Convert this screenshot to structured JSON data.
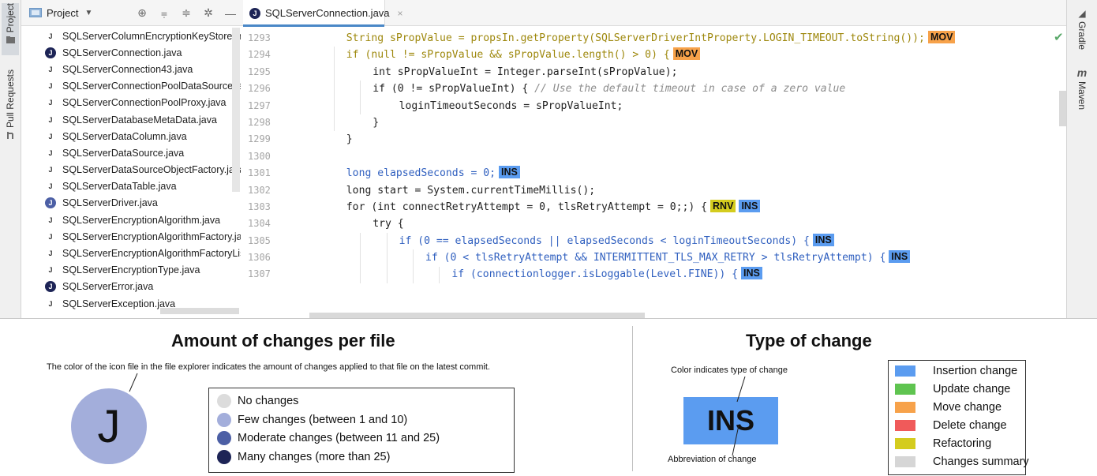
{
  "left_toolwindows": [
    {
      "label": "Project",
      "active": true
    },
    {
      "label": "Pull Requests",
      "active": false
    }
  ],
  "right_toolwindows": [
    {
      "label": "Gradle",
      "icon": "gradle-elephant-icon"
    },
    {
      "label": "Maven",
      "icon_text": "m"
    }
  ],
  "project_panel": {
    "title": "Project",
    "tools": [
      "target-icon",
      "collapse-all-icon",
      "expand-all-icon",
      "gear-icon",
      "minimize-icon"
    ]
  },
  "files": [
    {
      "name": "SQLServerColumnEncryptionKeyStorePro",
      "changes": "none"
    },
    {
      "name": "SQLServerConnection.java",
      "changes": "many"
    },
    {
      "name": "SQLServerConnection43.java",
      "changes": "none"
    },
    {
      "name": "SQLServerConnectionPoolDataSource.jav",
      "changes": "none"
    },
    {
      "name": "SQLServerConnectionPoolProxy.java",
      "changes": "none"
    },
    {
      "name": "SQLServerDatabaseMetaData.java",
      "changes": "none"
    },
    {
      "name": "SQLServerDataColumn.java",
      "changes": "none"
    },
    {
      "name": "SQLServerDataSource.java",
      "changes": "none"
    },
    {
      "name": "SQLServerDataSourceObjectFactory.java",
      "changes": "none"
    },
    {
      "name": "SQLServerDataTable.java",
      "changes": "none"
    },
    {
      "name": "SQLServerDriver.java",
      "changes": "moderate"
    },
    {
      "name": "SQLServerEncryptionAlgorithm.java",
      "changes": "none"
    },
    {
      "name": "SQLServerEncryptionAlgorithmFactory.jav",
      "changes": "none"
    },
    {
      "name": "SQLServerEncryptionAlgorithmFactoryList",
      "changes": "none"
    },
    {
      "name": "SQLServerEncryptionType.java",
      "changes": "none"
    },
    {
      "name": "SQLServerError.java",
      "changes": "many"
    },
    {
      "name": "SQLServerException.java",
      "changes": "none"
    }
  ],
  "file_icon_letter": "J",
  "editor_tab": {
    "title": "SQLServerConnection.java",
    "close": "×"
  },
  "code_lines": [
    {
      "num": "1293",
      "indent": 2,
      "text": "String sPropValue = propsIn.getProperty(SQLServerDriverIntProperty.LOGIN_TIMEOUT.toString());",
      "color": "#9e880d",
      "tags": [
        "MOV"
      ]
    },
    {
      "num": "1294",
      "indent": 2,
      "text": "if (null != sPropValue && sPropValue.length() > 0) {",
      "color": "#9e880d",
      "tags": [
        "MOV"
      ]
    },
    {
      "num": "1295",
      "indent": 3,
      "text": "int sPropValueInt = Integer.parseInt(sPropValue);",
      "color": "#222222",
      "tags": []
    },
    {
      "num": "1296",
      "indent": 3,
      "text": "if (0 != sPropValueInt) { ",
      "color": "#222222",
      "comment": "// Use the default timeout in case of a zero value",
      "tags": []
    },
    {
      "num": "1297",
      "indent": 4,
      "text": "loginTimeoutSeconds = sPropValueInt;",
      "color": "#222222",
      "tags": []
    },
    {
      "num": "1298",
      "indent": 3,
      "text": "}",
      "color": "#222222",
      "tags": []
    },
    {
      "num": "1299",
      "indent": 2,
      "text": "}",
      "color": "#222222",
      "tags": []
    },
    {
      "num": "1300",
      "indent": 0,
      "text": "",
      "color": "#222222",
      "tags": []
    },
    {
      "num": "1301",
      "indent": 2,
      "text": "long elapsedSeconds = 0;",
      "color": "#2f5fbf",
      "tags": [
        "INS"
      ]
    },
    {
      "num": "1302",
      "indent": 2,
      "text": "long start = System.currentTimeMillis();",
      "color": "#222222",
      "tags": []
    },
    {
      "num": "1303",
      "indent": 2,
      "text": "for (int connectRetryAttempt = 0, tlsRetryAttempt = 0;;) {",
      "color": "#222222",
      "tags": [
        "RNV",
        "INS"
      ]
    },
    {
      "num": "1304",
      "indent": 3,
      "text": "try {",
      "color": "#222222",
      "tags": []
    },
    {
      "num": "1305",
      "indent": 4,
      "text": "if (0 == elapsedSeconds || elapsedSeconds < loginTimeoutSeconds) {",
      "color": "#2f5fbf",
      "tags": [
        "INS"
      ]
    },
    {
      "num": "1306",
      "indent": 5,
      "text": "if (0 < tlsRetryAttempt && INTERMITTENT_TLS_MAX_RETRY > tlsRetryAttempt) {",
      "color": "#2f5fbf",
      "tags": [
        "INS"
      ]
    },
    {
      "num": "1307",
      "indent": 6,
      "text": "if (connectionlogger.isLoggable(Level.FINE)) {",
      "color": "#2f5fbf",
      "tags": [
        "INS"
      ]
    }
  ],
  "tag_colors": {
    "INS": "#5b9cf0",
    "MOV": "#f7a24a",
    "RNV": "#d4cc1e",
    "UPD": "#5fc450",
    "DEL": "#f05a5a"
  },
  "change_level_colors": {
    "none": "#dcdcdc",
    "few": "#a3aedb",
    "moderate": "#4c5fa5",
    "many": "#1d2456"
  },
  "legend_files": {
    "title": "Amount of changes per file",
    "description": "The color of the icon file in the file explorer indicates the amount of changes applied to that file on the latest commit.",
    "example_letter": "J",
    "example_level": "few",
    "items": [
      {
        "label": "No changes",
        "level": "none"
      },
      {
        "label": "Few changes (between 1 and 10)",
        "level": "few"
      },
      {
        "label": "Moderate changes (between 11 and 25)",
        "level": "moderate"
      },
      {
        "label": "Many changes (more than 25)",
        "level": "many"
      }
    ]
  },
  "legend_types": {
    "title": "Type of change",
    "color_note": "Color indicates type of change",
    "abbr_note": "Abbreviation of change",
    "example_abbr": "INS",
    "example_color": "#5b9cf0",
    "items": [
      {
        "label": "Insertion change",
        "color": "#5b9cf0"
      },
      {
        "label": "Update change",
        "color": "#5fc450"
      },
      {
        "label": "Move change",
        "color": "#f7a24a"
      },
      {
        "label": "Delete change",
        "color": "#f05a5a"
      },
      {
        "label": "Refactoring",
        "color": "#d4cc1e"
      },
      {
        "label": "Changes summary",
        "color": "#d6d6d6"
      }
    ]
  }
}
